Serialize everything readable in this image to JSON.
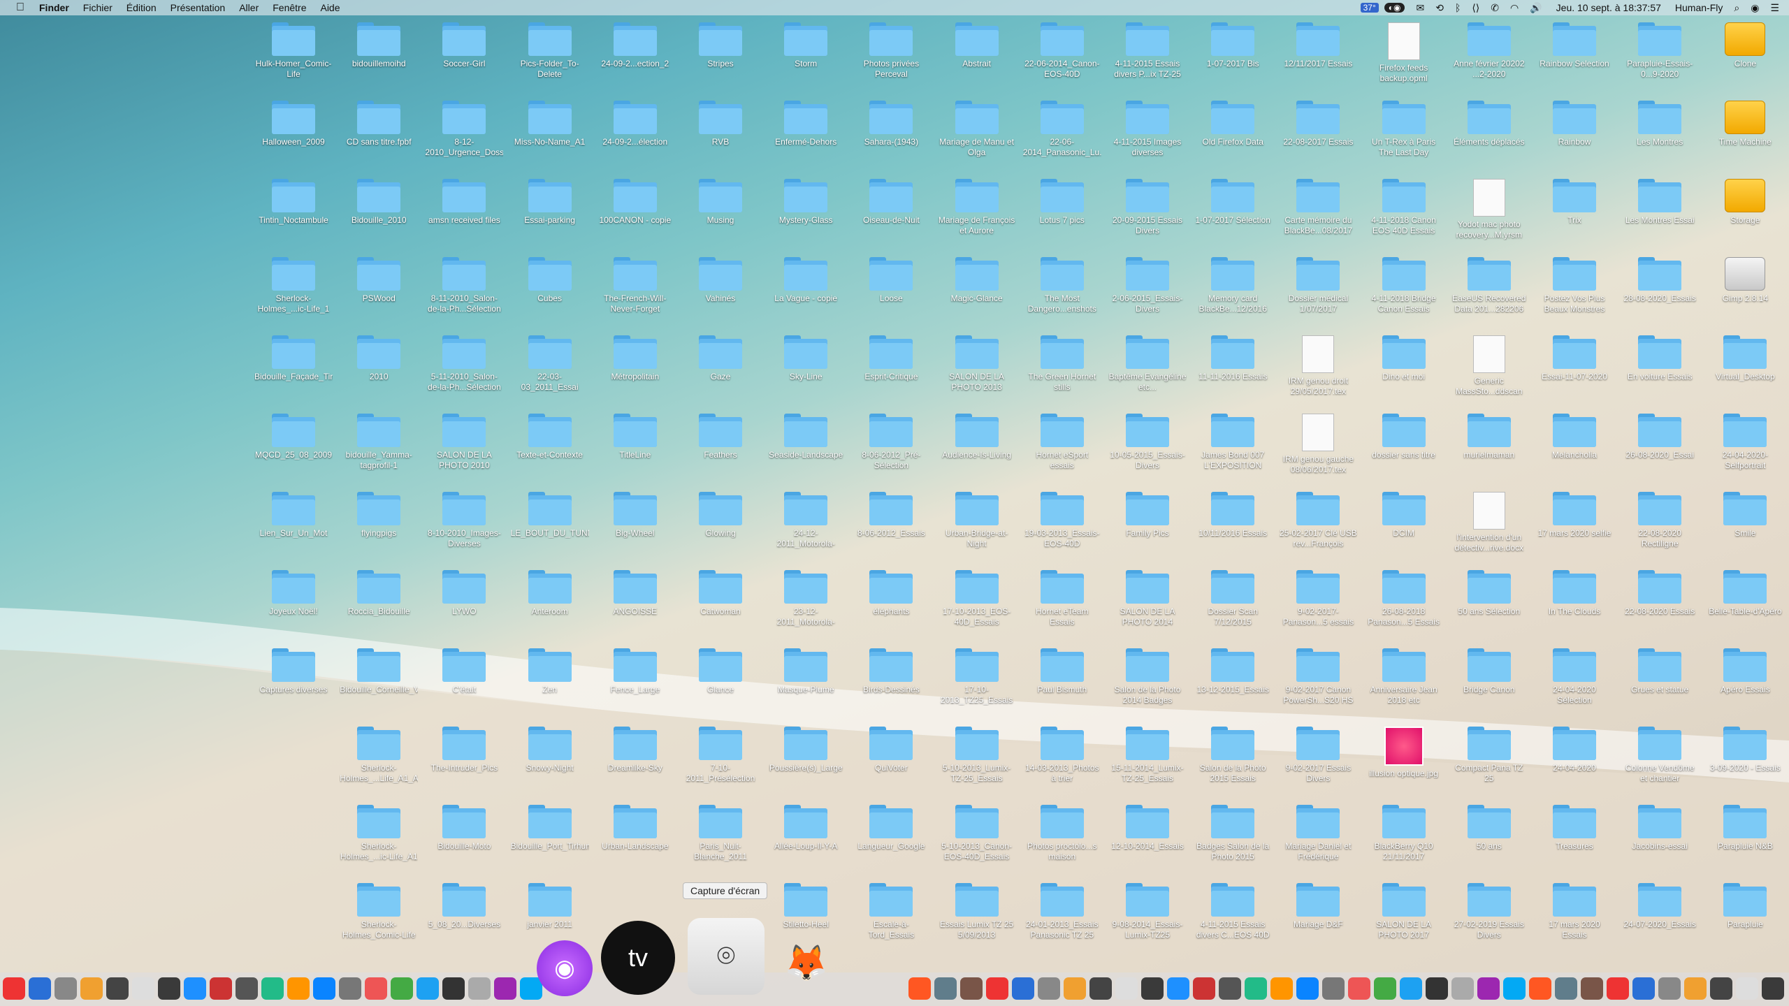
{
  "menubar": {
    "apple": "",
    "app": "Finder",
    "items": [
      "Fichier",
      "Édition",
      "Présentation",
      "Aller",
      "Fenêtre",
      "Aide"
    ],
    "battery": "37°",
    "clock": "Jeu. 10 sept. à 18:37:57",
    "user": "Human-Fly"
  },
  "desktop": {
    "rows": [
      [
        "Hulk-Homer_Comic-Life",
        "bidouillemoihd",
        "Soccer-Girl",
        "Pics-Folder_To-Delete",
        "24-09-2...ection_2",
        "Stripes",
        "Storm",
        "Photos privées Perceval",
        "Abstrait",
        "22-06-2014_Canon-EOS-40D",
        "4-11-2015 Essais divers P...ix TZ-25",
        "1-07-2017 Bis",
        "12/11/2017 Essais",
        "Firefox feeds backup.opml",
        "Anne février 20202 ...2-2020",
        "Rainbow Selection",
        "Parapluie-Essais-0...9-2020",
        "Clone"
      ],
      [
        "Halloween_2009",
        "CD sans titre.fpbf",
        "8-12-2010_Urgence_Dossier-Photos",
        "Miss-No-Name_A1",
        "24-09-2...élection",
        "RVB",
        "Enfermé-Dehors",
        "Sahara-(1943)",
        "Mariage de Manu et Olga",
        "22-06-2014_Panasonic_Lu...s-Divers",
        "4-11-2015 Images diverses",
        "Old Firefox Data",
        "22-08-2017 Essais",
        "Un T-Rex à Paris The Last Day",
        "Éléments déplacés",
        "Rainbow",
        "Les Montres",
        "Time Machine"
      ],
      [
        "Tintin_Noctambule",
        "Bidouille_2010",
        "amsn received files",
        "Essai-parking",
        "100CANON - copie",
        "Musing",
        "Mystery-Glass",
        "Oiseau-de-Nuit",
        "Mariage de François et Aurore",
        "Lotus 7 pics",
        "20-09-2015 Essais Divers",
        "1-07-2017 Sélection",
        "Carte mémoire du BlackBe...08/2017",
        "4-11-2018 Canon EOS 40D Essais",
        "Yodot mac photo recovery...M.yrsm",
        "Trix",
        "Les Montres Essai",
        "Storage"
      ],
      [
        "Sherlock-Holmes_...ic-Life_1",
        "PSWood",
        "8-11-2010_Salon-de-la-Ph...Sélection",
        "Cubes",
        "The-French-Will-Never-Forget",
        "Vahinés",
        "La Vague - copie",
        "Loose",
        "Magic-Glance",
        "The Most Dangero...enshots",
        "2-06-2015_Essais-Divers",
        "Memory card BlackBe...12/2016",
        "Dossier médical 1/07/2017",
        "4-11-2018 Bridge Canon Essais",
        "EaseUS Recovered Data 201...282206",
        "Postez Vos Plus Beaux Monstres",
        "28-08-2020_Essais",
        "Gimp 2.8.14"
      ],
      [
        "Bidouille_Façade_Tirhum",
        "2010",
        "5-11-2010_Salon-de-la-Ph...Sélection",
        "22-03-03_2011_Essai",
        "Métropolitain",
        "Gaze",
        "Sky-Line",
        "Esprit-Critique",
        "SALON DE LA PHOTO 2013",
        "The Green Hornet stills",
        "Baptême Evangéline etc...",
        "11-11-2016 Essais",
        "IRM genou droit 29/05/2017.tex",
        "Dino et moi",
        "Generic MassSto...ddscan",
        "Essai-11-07-2020",
        "En voiture Essais",
        "Virtual_Desktop"
      ],
      [
        "MQCD_25_08_2009",
        "bidouille_Yamma-tagprofil-1",
        "SALON DE LA PHOTO 2010",
        "Texte-et-Contexte",
        "TitleLine",
        "Feathers",
        "Seaside-Landscape",
        "8-06-2012_Pré-Sélection",
        "Audience-Is-Living",
        "Hornet eSport essais",
        "10-05-2015_Essais-Divers",
        "James Bond 007 L'EXPOSITION",
        "IRM genou gauche 08/06/2017.tex",
        "dossier sans titre",
        "murielmaman",
        "Melancholia",
        "26-08-2020_Essai",
        "24-04-2020-Selfportrait"
      ],
      [
        "Lien_Sur_Un_Mot",
        "flyingpigs",
        "8-10-2010_Images-Diverses",
        "LE_BOUT_DU_TUNNEL",
        "Big-Wheel",
        "Glowing",
        "24-12-2011_Motorola-Dext_Pics",
        "8-06-2012_Essais",
        "Urban-Bridge-at-Night",
        "19-03-2013_Essais-EOS-40D",
        "Family Pics",
        "10/11/2016 Essais",
        "25-02-2017 Clé USB rev...François",
        "DCIM",
        "l'intervention d'un détectiv...rive.docx",
        "17 mars 2020 selfie",
        "22-08-2020 Rectiligne",
        "Smile"
      ],
      [
        "Joyeux Noël!",
        "Roccia_Bidouille",
        "LYWO",
        "Anteroom",
        "ANGOISSE",
        "Catwoman",
        "23-12-2011_Motorola-Dext_Pics",
        "éléphants",
        "17-10-2013_EOS-40D_Essais",
        "Hornet eTeam Essais",
        "SALON DE LA PHOTO 2014",
        "Dossier Scan 7/12/2015",
        "9-02-2017-Panason...5 essais",
        "26-08-2018 Panason...5 Essais",
        "50 ans Sélection",
        "In The Clouds",
        "22-08-2020 Essais",
        "Belle-Table-d'Apéro"
      ],
      [
        "Captures diverses",
        "Bidouille_Corneille_Venise",
        "C'était",
        "Zen",
        "Fence_Large",
        "Glance",
        "Masque-Plume",
        "Birds-Dessinés",
        "17-10-2013_TZ25_Essais",
        "Paul Bismuth",
        "Salon de la Photo 2014 Badges",
        "13-12-2015_Essais",
        "9-02-2017 Canon PowerSh...S20 HS",
        "Anniversaire Jean 2018 etc",
        "Bridge Canon",
        "24-04-2020 Sélection",
        "Grues et statue",
        "Apéro Essais"
      ],
      [
        "",
        "Sherlock-Holmes_...Life_A1_A",
        "The-Intruder_Pics",
        "Snowy-Night",
        "Dreamlike-Sky",
        "7-10-2011_Présélection",
        "Poussière(s)_Large",
        "QuiVoter",
        "5-10-2013_Lumix-TZ-25_Essais",
        "14-03-2013_Photos à trier",
        "15-11-2014_Lumix-TZ-25_Essais",
        "Salon de la Photo 2015 Essais",
        "9-02-2017 Essais Divers",
        "illusion optique.jpg",
        "Compact Pana TZ 25",
        "24-04-2020",
        "Colonne Vendôme et chantier",
        "3-09-2020 - Essais"
      ],
      [
        "",
        "Sherlock-Holmes_...ic-Life_A1",
        "Bidouille-Moto",
        "Bidouille_Port_Tirhum",
        "Urban-Landscape",
        "Paris_Nuit-Blanche_2011",
        "Allée-Loup-Il-Y-A",
        "Langueur_Google",
        "5-10-2013_Canon-EOS-40D_Essais",
        "Photos proctolo...s maison",
        "12-10-2014_Essais",
        "Badges Salon de la Photo 2015",
        "Mariage Daniel et Frédérique",
        "BlackBerry Q10 21/11/2017",
        "50 ans",
        "Treasures",
        "Jacobins-essai",
        "Parapluie N&B"
      ],
      [
        "",
        "Sherlock-Holmes_Comic-Life",
        "5_08_20...Diverses",
        "janvier 2011",
        "",
        "",
        "Stiletto-Heel",
        "Escale-à-Tord_Essais",
        "Essais Lumix TZ 25 5/09/2013",
        "24-01-2013_Essais Panasonic TZ 25",
        "9-08-2014_Essais-Lumix-TZ25",
        "4-11-2015 Essais divers C...EOS 40D",
        "Mariage D&F",
        "SALON DE LA PHOTO 2017",
        "27-02-2019 Essais Divers",
        "17 mars 2020 Essais",
        "24-07-2020_Essais",
        "Parapluie"
      ]
    ]
  },
  "tooltip": "Capture d'écran",
  "dock": {
    "big_apps": [
      "Podcasts",
      "TV",
      "Capture d'écran",
      "GIMP"
    ],
    "tv_label": "tv"
  }
}
